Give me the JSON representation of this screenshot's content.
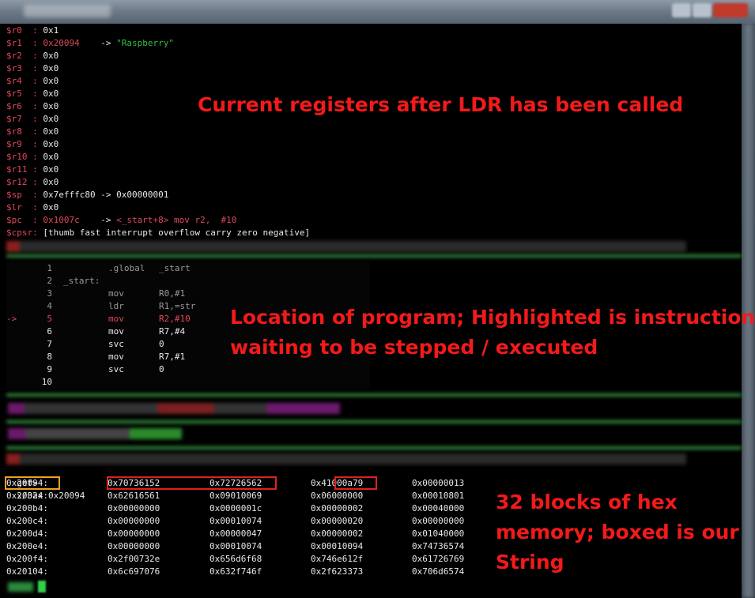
{
  "registers": [
    {
      "name": "$r0  :",
      "value": "0x1",
      "changed": false,
      "arrow": "",
      "target": ""
    },
    {
      "name": "$r1  :",
      "value": "0x20094",
      "changed": true,
      "arrow": "->",
      "target": "\"Raspberry\""
    },
    {
      "name": "$r2  :",
      "value": "0x0",
      "changed": false,
      "arrow": "",
      "target": ""
    },
    {
      "name": "$r3  :",
      "value": "0x0",
      "changed": false,
      "arrow": "",
      "target": ""
    },
    {
      "name": "$r4  :",
      "value": "0x0",
      "changed": false,
      "arrow": "",
      "target": ""
    },
    {
      "name": "$r5  :",
      "value": "0x0",
      "changed": false,
      "arrow": "",
      "target": ""
    },
    {
      "name": "$r6  :",
      "value": "0x0",
      "changed": false,
      "arrow": "",
      "target": ""
    },
    {
      "name": "$r7  :",
      "value": "0x0",
      "changed": false,
      "arrow": "",
      "target": ""
    },
    {
      "name": "$r8  :",
      "value": "0x0",
      "changed": false,
      "arrow": "",
      "target": ""
    },
    {
      "name": "$r9  :",
      "value": "0x0",
      "changed": false,
      "arrow": "",
      "target": ""
    },
    {
      "name": "$r10 :",
      "value": "0x0",
      "changed": false,
      "arrow": "",
      "target": ""
    },
    {
      "name": "$r11 :",
      "value": "0x0",
      "changed": false,
      "arrow": "",
      "target": ""
    },
    {
      "name": "$r12 :",
      "value": "0x0",
      "changed": false,
      "arrow": "",
      "target": ""
    },
    {
      "name": "$sp  :",
      "value": "0x7efffc80",
      "changed": false,
      "arrow": "->",
      "target": "0x00000001"
    },
    {
      "name": "$lr  :",
      "value": "0x0",
      "changed": false,
      "arrow": "",
      "target": ""
    },
    {
      "name": "$pc  :",
      "value": "0x1007c",
      "changed": true,
      "arrow": "->",
      "target": "<_start+8> mov r2,  #10"
    },
    {
      "name": "$cpsr:",
      "value": "[thumb fast interrupt overflow carry zero negative]",
      "changed": false,
      "arrow": "",
      "target": ""
    }
  ],
  "source": [
    {
      "marker": "",
      "num": "1",
      "label": "",
      "op": ".global",
      "args": "_start",
      "current": false,
      "dim": true
    },
    {
      "marker": "",
      "num": "2",
      "label": "_start:",
      "op": "",
      "args": "",
      "current": false,
      "dim": true
    },
    {
      "marker": "",
      "num": "3",
      "label": "",
      "op": "mov",
      "args": "R0,#1",
      "current": false,
      "dim": true
    },
    {
      "marker": "",
      "num": "4",
      "label": "",
      "op": "ldr",
      "args": "R1,=str",
      "current": false,
      "dim": true
    },
    {
      "marker": "->",
      "num": "5",
      "label": "",
      "op": "mov",
      "args": "R2,#10",
      "current": true,
      "dim": false
    },
    {
      "marker": "",
      "num": "6",
      "label": "",
      "op": "mov",
      "args": "R7,#4",
      "current": false,
      "dim": false
    },
    {
      "marker": "",
      "num": "7",
      "label": "",
      "op": "svc",
      "args": "0",
      "current": false,
      "dim": false
    },
    {
      "marker": "",
      "num": "8",
      "label": "",
      "op": "mov",
      "args": "R7,#1",
      "current": false,
      "dim": false
    },
    {
      "marker": "",
      "num": "9",
      "label": "",
      "op": "svc",
      "args": "0",
      "current": false,
      "dim": false
    },
    {
      "marker": "",
      "num": "10",
      "label": "",
      "op": "",
      "args": "",
      "current": false,
      "dim": false
    }
  ],
  "command": {
    "prompt": "gef>",
    "text": "x/32x 0x20094"
  },
  "memory": [
    {
      "addr": "0x20094:",
      "words": [
        "0x70736152",
        "0x72726562",
        "0x41000a79",
        "0x00000013"
      ]
    },
    {
      "addr": "0x200a4:",
      "words": [
        "0x62616561",
        "0x09010069",
        "0x06000000",
        "0x00010801"
      ]
    },
    {
      "addr": "0x200b4:",
      "words": [
        "0x00000000",
        "0x0000001c",
        "0x00000002",
        "0x00040000"
      ]
    },
    {
      "addr": "0x200c4:",
      "words": [
        "0x00000000",
        "0x00010074",
        "0x00000020",
        "0x00000000"
      ]
    },
    {
      "addr": "0x200d4:",
      "words": [
        "0x00000000",
        "0x00000047",
        "0x00000002",
        "0x01040000"
      ]
    },
    {
      "addr": "0x200e4:",
      "words": [
        "0x00000000",
        "0x00010074",
        "0x00010094",
        "0x74736574"
      ]
    },
    {
      "addr": "0x200f4:",
      "words": [
        "0x2f00732e",
        "0x656d6f68",
        "0x746e612f",
        "0x61726769"
      ]
    },
    {
      "addr": "0x20104:",
      "words": [
        "0x6c697076",
        "0x632f746f",
        "0x2f623373",
        "0x706d6574"
      ]
    }
  ],
  "annotations": {
    "registers": "Current registers after LDR has been called",
    "program_line1": "Location of program; Highlighted is instruction",
    "program_line2": "waiting to be stepped / executed",
    "memory_line1": "32 blocks of hex",
    "memory_line2": "memory; boxed is our",
    "memory_line3": "String"
  },
  "colors": {
    "annotation": "#f21a1a",
    "reg_name": "#e0495a",
    "string": "#2fbf3f",
    "addr_box": "#f0a020",
    "word_box": "#e02020"
  }
}
